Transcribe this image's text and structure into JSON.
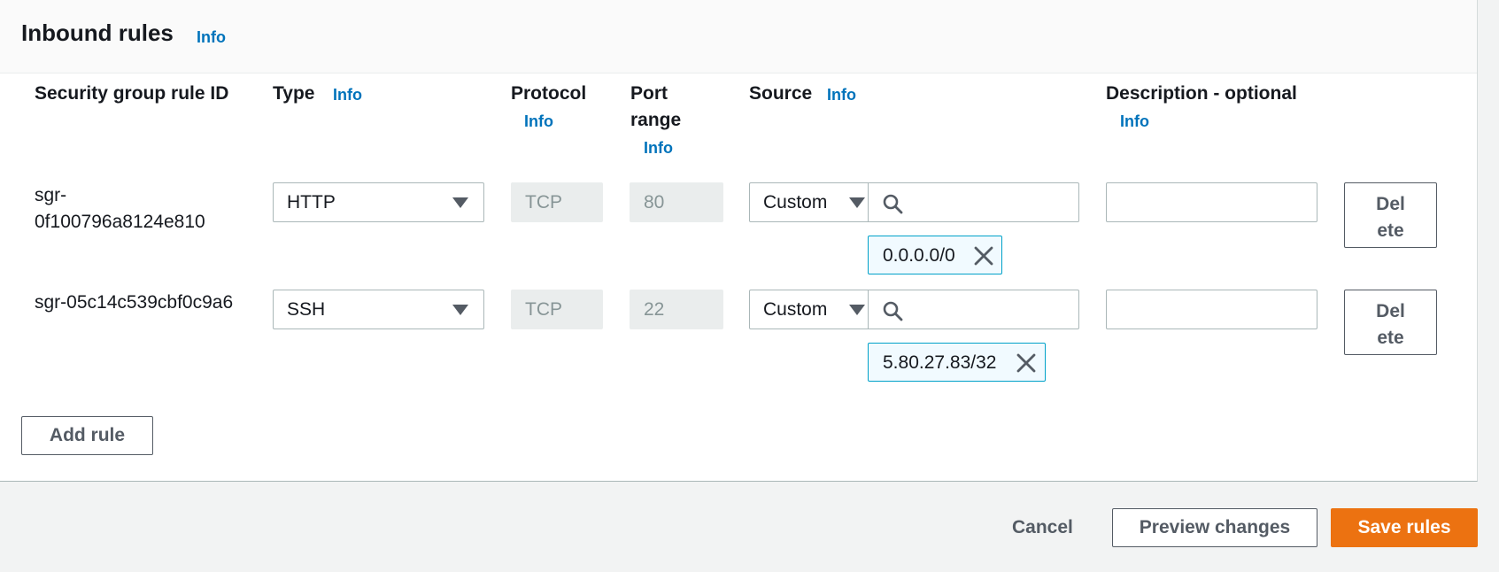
{
  "panel": {
    "title": "Inbound rules",
    "title_info": "Info"
  },
  "columns": {
    "rule_id": "Security group rule ID",
    "type": "Type",
    "type_info": "Info",
    "protocol": "Protocol",
    "protocol_info": "Info",
    "port_line1": "Port",
    "port_line2": "range",
    "port_info": "Info",
    "source": "Source",
    "source_info": "Info",
    "description": "Description - optional",
    "description_info": "Info"
  },
  "rules": [
    {
      "id_line1": "sgr-",
      "id_line2": "0f100796a8124e810",
      "type": "HTTP",
      "protocol": "TCP",
      "port": "80",
      "source_mode": "Custom",
      "search_value": "",
      "cidr": "0.0.0.0/0",
      "description": "",
      "delete_line1": "Del",
      "delete_line2": "ete"
    },
    {
      "id_line1": "sgr-05c14c539cbf0c9a6",
      "type": "SSH",
      "protocol": "TCP",
      "port": "22",
      "source_mode": "Custom",
      "search_value": "",
      "cidr": "5.80.27.83/32",
      "description": "",
      "delete_line1": "Del",
      "delete_line2": "ete"
    }
  ],
  "actions": {
    "add_rule": "Add rule",
    "cancel": "Cancel",
    "preview": "Preview changes",
    "save": "Save rules"
  },
  "colors": {
    "accent": "#ec7211",
    "link": "#0073bb",
    "token_border": "#00a1c9"
  },
  "icons": {
    "search": "search-icon",
    "remove": "close-icon",
    "caret": "caret-down-icon"
  }
}
